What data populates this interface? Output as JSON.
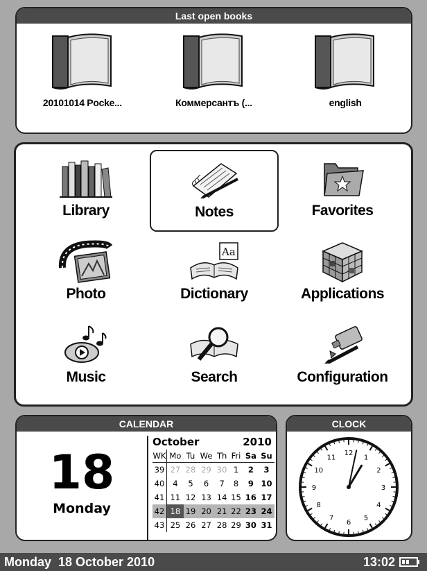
{
  "last_books": {
    "title": "Last open books",
    "items": [
      {
        "title": "20101014 Pocke..."
      },
      {
        "title": "Коммерсантъ (..."
      },
      {
        "title": "english"
      }
    ]
  },
  "menu": {
    "items": [
      {
        "label": "Library",
        "icon": "books-icon"
      },
      {
        "label": "Notes",
        "icon": "notepad-pen-icon",
        "selected": true
      },
      {
        "label": "Favorites",
        "icon": "folder-star-icon"
      },
      {
        "label": "Photo",
        "icon": "film-photo-icon"
      },
      {
        "label": "Dictionary",
        "icon": "dictionary-book-icon"
      },
      {
        "label": "Applications",
        "icon": "cube-icon"
      },
      {
        "label": "Music",
        "icon": "music-note-icon"
      },
      {
        "label": "Search",
        "icon": "magnifier-book-icon"
      },
      {
        "label": "Configuration",
        "icon": "tools-icon"
      }
    ]
  },
  "calendar": {
    "title": "CALENDAR",
    "day_number": "18",
    "weekday": "Monday",
    "month": "October",
    "year": "2010",
    "headers": [
      "WK",
      "Mo",
      "Tu",
      "We",
      "Th",
      "Fri",
      "Sa",
      "Su"
    ],
    "weeks": [
      [
        "39",
        "27",
        "28",
        "29",
        "30",
        "1",
        "2",
        "3"
      ],
      [
        "40",
        "4",
        "5",
        "6",
        "7",
        "8",
        "9",
        "10"
      ],
      [
        "41",
        "11",
        "12",
        "13",
        "14",
        "15",
        "16",
        "17"
      ],
      [
        "42",
        "18",
        "19",
        "20",
        "21",
        "22",
        "23",
        "24"
      ],
      [
        "43",
        "25",
        "26",
        "27",
        "28",
        "29",
        "30",
        "31"
      ]
    ]
  },
  "clock": {
    "title": "CLOCK",
    "numbers": [
      "12",
      "1",
      "2",
      "3",
      "4",
      "5",
      "6",
      "7",
      "8",
      "9",
      "10",
      "11"
    ],
    "time": "13:02"
  },
  "status_bar": {
    "date": "Monday  18 October 2010",
    "time": "13:02"
  }
}
